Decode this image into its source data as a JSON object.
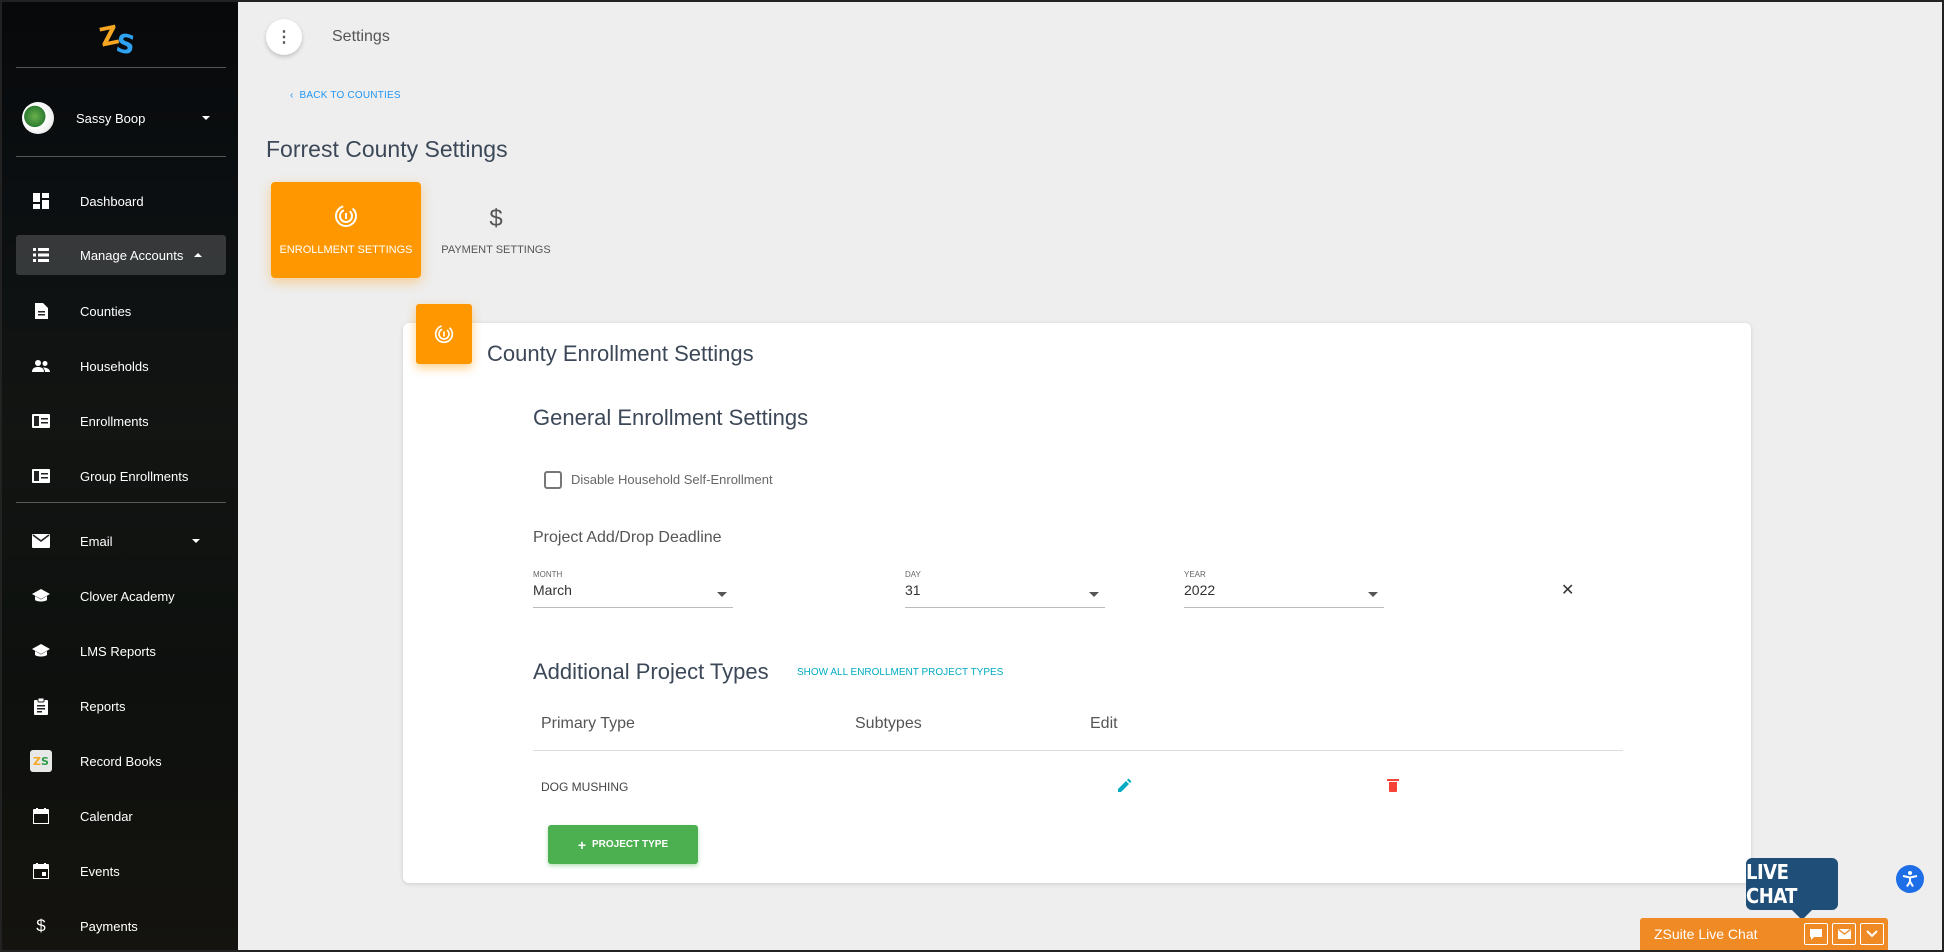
{
  "sidebar": {
    "user_name": "Sassy Boop",
    "items": [
      {
        "label": "Dashboard",
        "icon": "dashboard-icon"
      },
      {
        "label": "Manage Accounts",
        "icon": "list-icon"
      },
      {
        "label": "Counties",
        "icon": "document-icon"
      },
      {
        "label": "Households",
        "icon": "people-icon"
      },
      {
        "label": "Enrollments",
        "icon": "id-card-icon"
      },
      {
        "label": "Group Enrollments",
        "icon": "id-card-icon"
      },
      {
        "label": "Email",
        "icon": "mail-icon"
      },
      {
        "label": "Clover Academy",
        "icon": "school-icon"
      },
      {
        "label": "LMS Reports",
        "icon": "school-icon"
      },
      {
        "label": "Reports",
        "icon": "clipboard-icon"
      },
      {
        "label": "Record Books",
        "icon": "zs-logo-icon"
      },
      {
        "label": "Calendar",
        "icon": "calendar-icon"
      },
      {
        "label": "Events",
        "icon": "event-icon"
      },
      {
        "label": "Payments",
        "icon": "dollar-icon"
      }
    ]
  },
  "topbar": {
    "title": "Settings"
  },
  "page": {
    "back_link": "BACK TO COUNTIES",
    "title": "Forrest County Settings",
    "tabs": [
      {
        "label": "ENROLLMENT SETTINGS",
        "icon": "fingerprint-icon",
        "active": true
      },
      {
        "label": "PAYMENT SETTINGS",
        "icon": "dollar-icon",
        "active": false
      }
    ]
  },
  "card": {
    "title": "County Enrollment Settings",
    "general_title": "General Enrollment Settings",
    "checkbox_label": "Disable Household Self-Enrollment",
    "checkbox_checked": false,
    "deadline_label": "Project Add/Drop Deadline",
    "month": {
      "label": "MONTH",
      "value": "March"
    },
    "day": {
      "label": "DAY",
      "value": "31"
    },
    "year": {
      "label": "YEAR",
      "value": "2022"
    },
    "additional_title": "Additional Project Types",
    "show_all_link": "SHOW ALL ENROLLMENT PROJECT TYPES",
    "table": {
      "headers": [
        "Primary Type",
        "Subtypes",
        "Edit"
      ],
      "rows": [
        {
          "primary": "DOG MUSHING",
          "subtypes": ""
        }
      ]
    },
    "add_button": "PROJECT TYPE"
  },
  "chat": {
    "bubble_text": "LIVE CHAT",
    "bar_label": "ZSuite Live Chat"
  },
  "colors": {
    "accent": "#ff9800",
    "success": "#4caf50",
    "link": "#2196f3",
    "danger": "#f44336"
  }
}
